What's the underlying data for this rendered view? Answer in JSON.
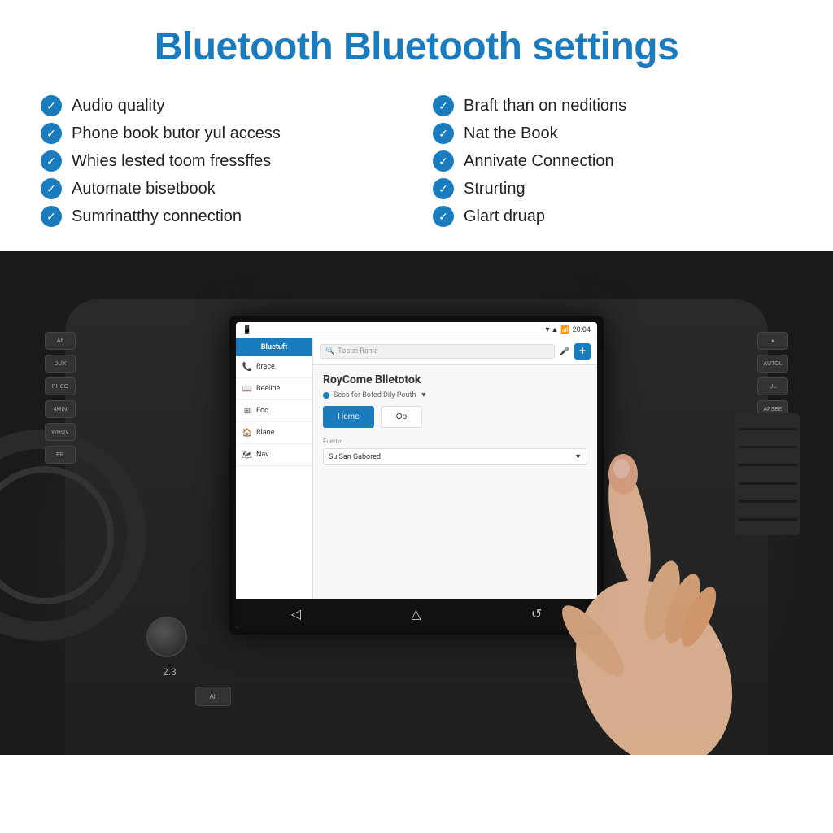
{
  "header": {
    "title": "Bluetooth Bluetooth settings"
  },
  "features": {
    "left": [
      "Audio quality",
      "Phone book butor yul access",
      "Whies lested toom fressffes",
      "Automate bisetbook",
      "Sumrinatthy connection"
    ],
    "right": [
      "Braft than on neditions",
      "Nat the Book",
      "Annivate Connection",
      "Strurting",
      "Glart druap"
    ]
  },
  "screen": {
    "sidebar_title": "Bluetuft",
    "sidebar_items": [
      "Rrace",
      "Beeline",
      "Eoo",
      "Rlane",
      "Nav"
    ],
    "search_placeholder": "Toatei Ranie",
    "welcome": "RoyCome Blletotok",
    "subtitle": "Secs for Boted Dily Pouth",
    "btn_primary": "Home",
    "btn_secondary": "Op",
    "dropdown_label": "Fuerns",
    "dropdown_value": "Su San Gabored",
    "version": "2.3"
  },
  "colors": {
    "blue": "#1a7bbf",
    "title_blue": "#1a8fd1",
    "dark_bg": "#1a1a1a"
  }
}
